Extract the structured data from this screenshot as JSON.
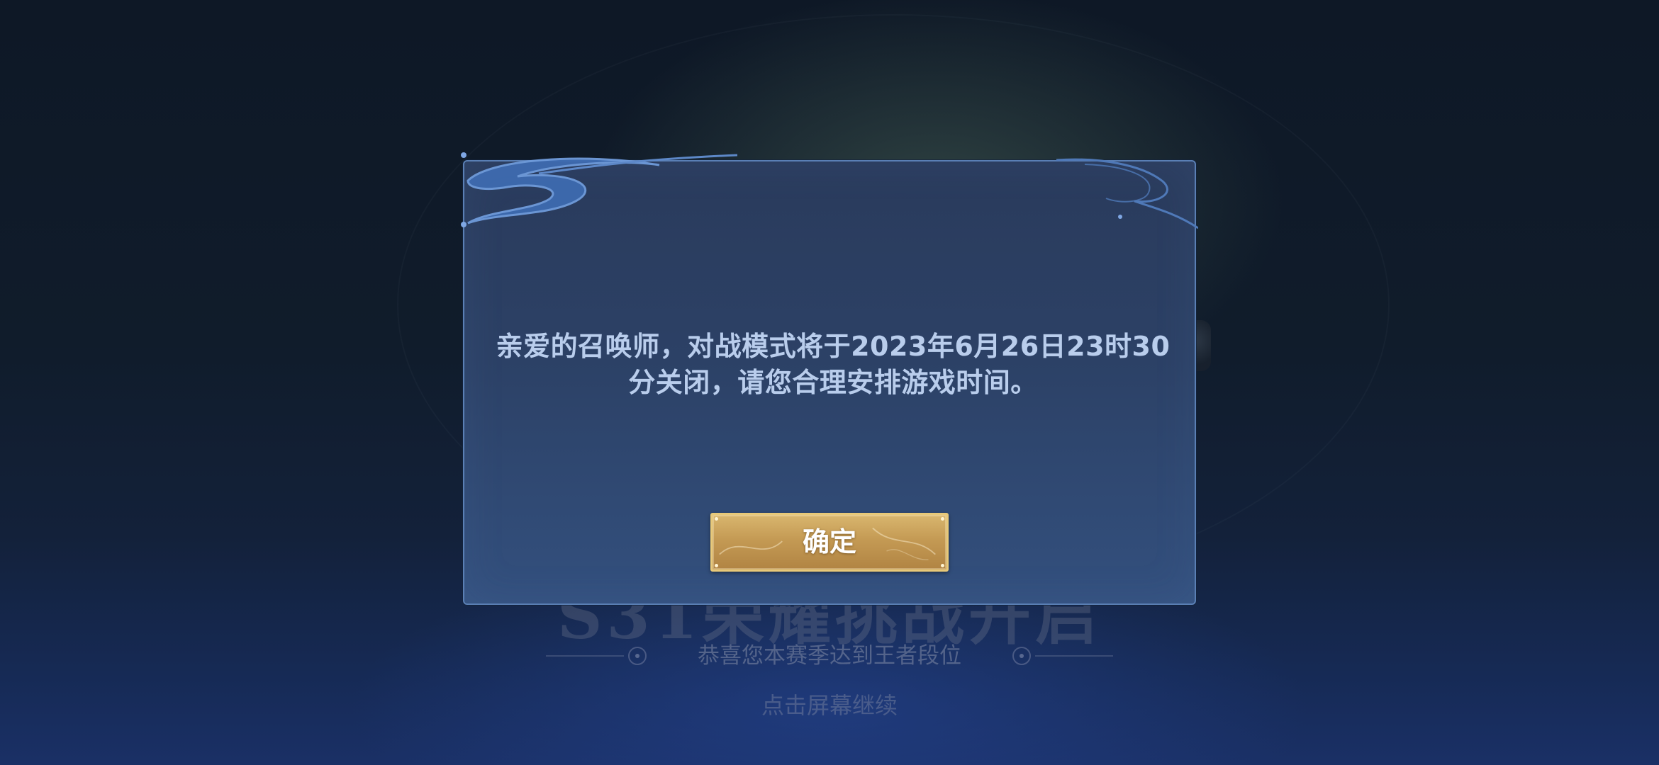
{
  "background": {
    "title": "S31荣耀挑战开启",
    "subtitle": "恭喜您本赛季达到王者段位",
    "continue_hint": "点击屏幕继续"
  },
  "dialog": {
    "message": "亲爱的召唤师，对战模式将于2023年6月26日23时30分关闭，请您合理安排游戏时间。",
    "confirm_label": "确定"
  },
  "colors": {
    "dialog_border": "#5a7fb4",
    "dialog_text": "#b9cdec",
    "button_gold": "#c49a54",
    "button_border": "#e8c979"
  }
}
